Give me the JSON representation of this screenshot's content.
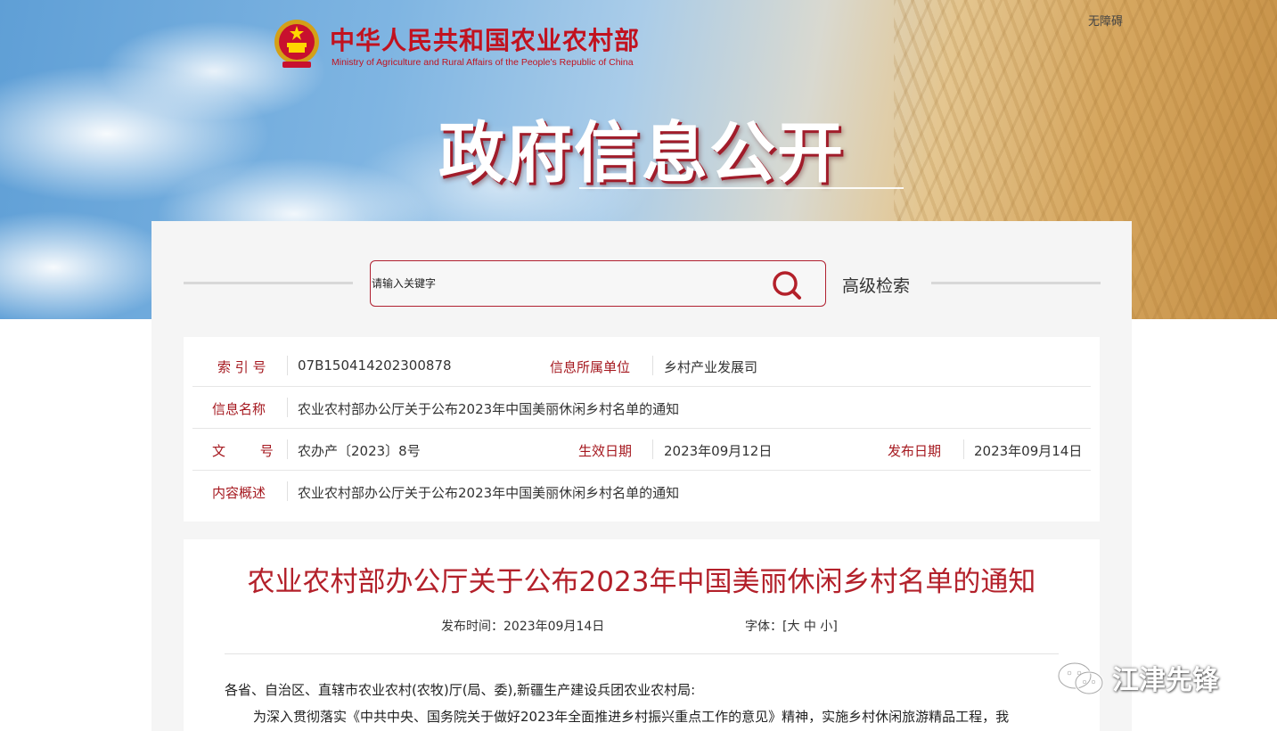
{
  "header": {
    "ministry_cn": "中华人民共和国农业农村部",
    "ministry_en": "Ministry of Agriculture and Rural Affairs of the People's Republic of China",
    "accessibility": "无障碍",
    "title": "政府信息公开",
    "emblem_icon": "national-emblem-icon"
  },
  "search": {
    "placeholder": "请输入关键字",
    "icon": "search-icon",
    "advanced_label": "高级检索"
  },
  "info": {
    "index_label": "索 引 号",
    "index_value": "07B150414202300878",
    "unit_label": "信息所属单位",
    "unit_value": "乡村产业发展司",
    "name_label": "信息名称",
    "name_value": "农业农村部办公厅关于公布2023年中国美丽休闲乡村名单的通知",
    "docno_label": "文 号",
    "docno_value": "农办产〔2023〕8号",
    "effective_label": "生效日期",
    "effective_value": "2023年09月12日",
    "publish_label": "发布日期",
    "publish_value": "2023年09月14日",
    "summary_label": "内容概述",
    "summary_value": "农业农村部办公厅关于公布2023年中国美丽休闲乡村名单的通知"
  },
  "article": {
    "title": "农业农村部办公厅关于公布2023年中国美丽休闲乡村名单的通知",
    "pub_time_label": "发布时间：",
    "pub_time": "2023年09月14日",
    "font_label": "字体：[",
    "font_large": "大",
    "font_medium": "中",
    "font_small": "小",
    "font_close": "]",
    "salutation": "各省、自治区、直辖市农业农村(农牧)厅(局、委),新疆生产建设兵团农业农村局:",
    "paragraph1": "为深入贯彻落实《中共中央、国务院关于做好2023年全面推进乡村振兴重点工作的意见》精神，实施乡村休闲旅游精品工程，我"
  },
  "watermark": {
    "text": "江津先锋",
    "icon": "wechat-icon"
  },
  "colors": {
    "brand_red": "#c1121f",
    "label_red": "#a5181f",
    "title_red": "#b3202a"
  }
}
